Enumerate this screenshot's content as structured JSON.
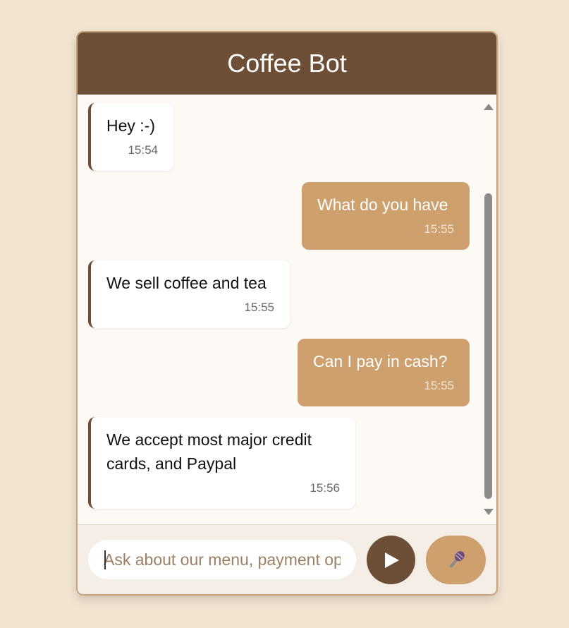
{
  "header": {
    "title": "Coffee Bot"
  },
  "messages": [
    {
      "sender": "bot",
      "text": "Hey :-)",
      "time": "15:54"
    },
    {
      "sender": "user",
      "text": "What do you have",
      "time": "15:55"
    },
    {
      "sender": "bot",
      "text": "We sell coffee and tea",
      "time": "15:55"
    },
    {
      "sender": "user",
      "text": "Can I pay in cash?",
      "time": "15:55"
    },
    {
      "sender": "bot",
      "text": "We accept most major credit cards, and Paypal",
      "time": "15:56"
    }
  ],
  "input": {
    "placeholder": "Ask about our menu, payment options, or hours",
    "value": ""
  },
  "buttons": {
    "send_icon": "play-icon",
    "mic_icon": "microphone-icon"
  },
  "colors": {
    "header": "#6d4f37",
    "user_bubble": "#cda06e",
    "bot_bubble": "#ffffff",
    "page_background": "#f2e4d1"
  }
}
